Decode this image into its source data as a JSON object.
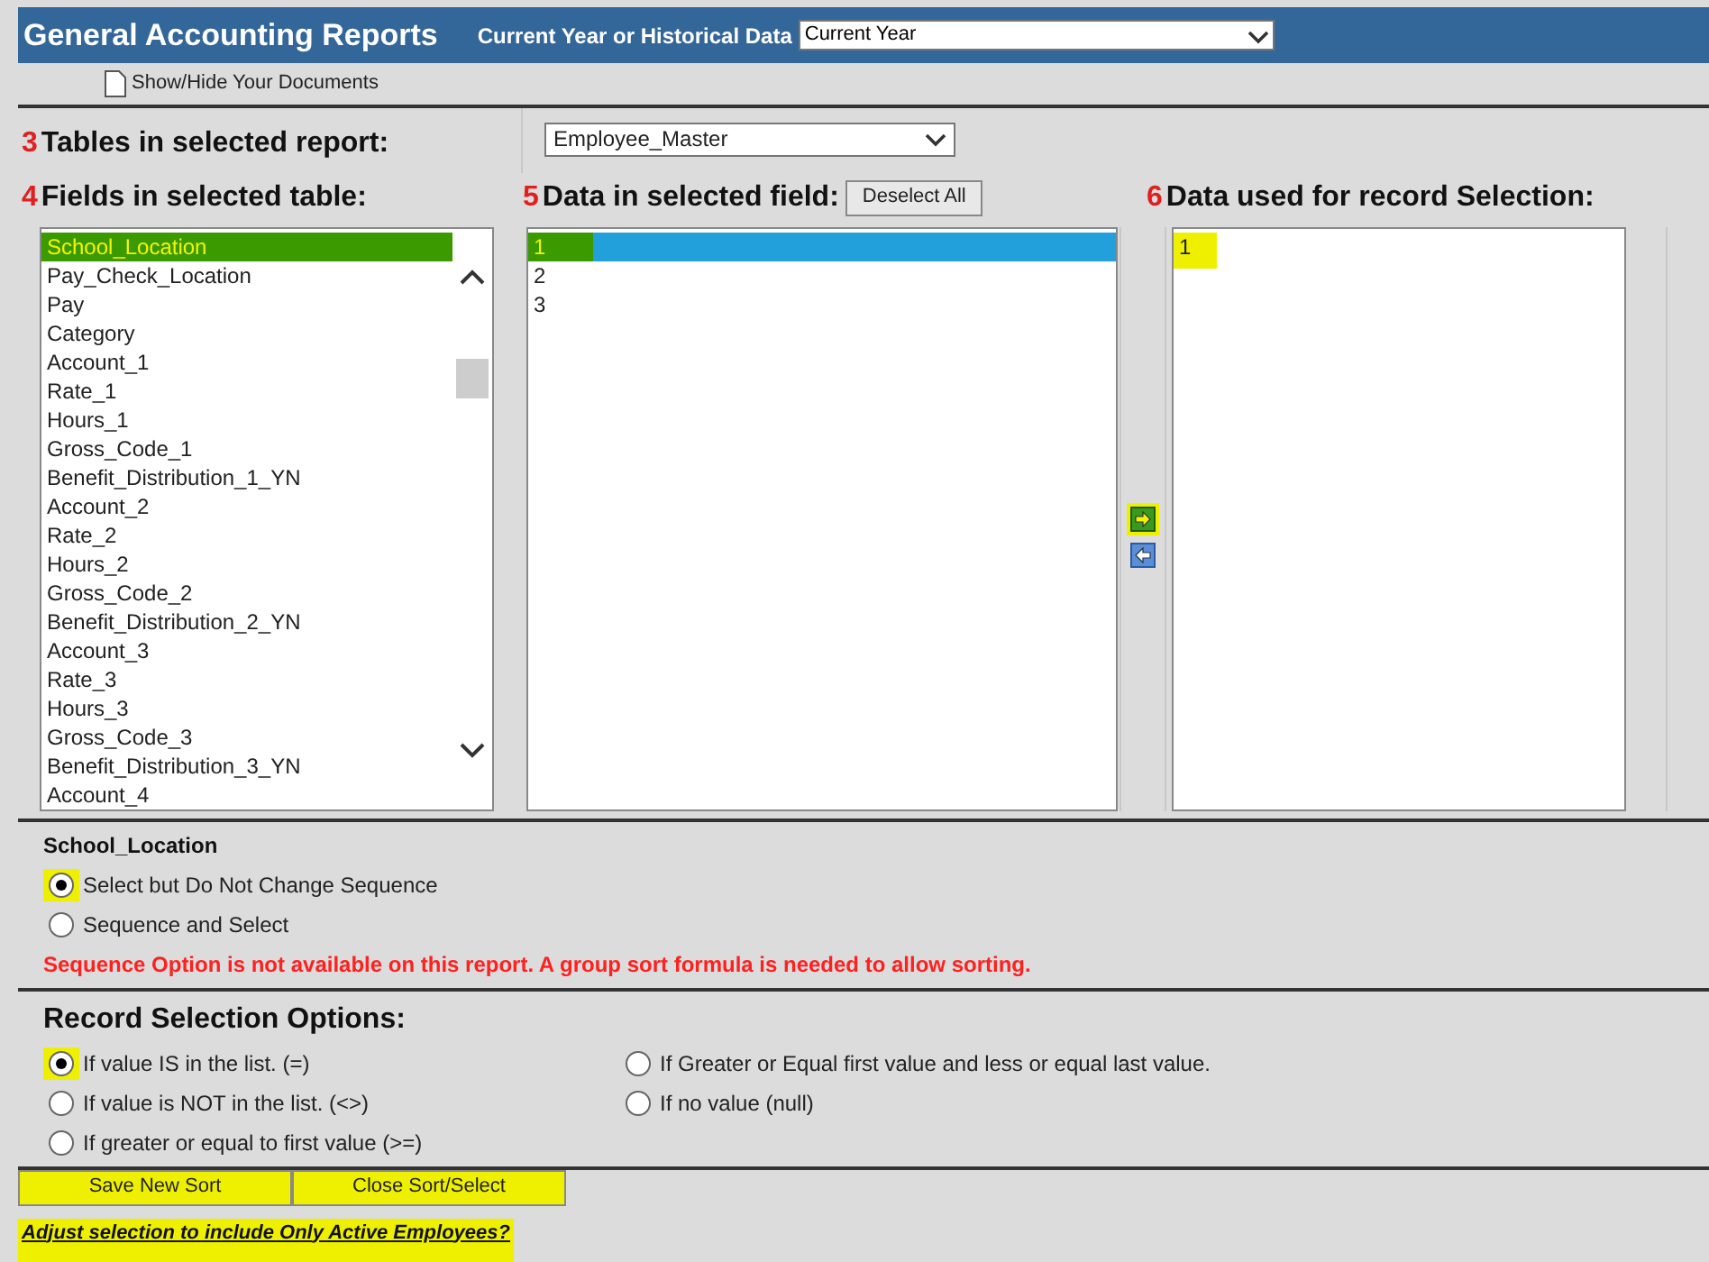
{
  "header": {
    "title": "General Accounting Reports",
    "year_label": "Current Year or Historical Data",
    "year_value": "Current Year"
  },
  "toolbar": {
    "documents_button": "Show/Hide Your Documents"
  },
  "tables": {
    "step": "3",
    "label": "Tables in selected report:",
    "value": "Employee_Master"
  },
  "fields": {
    "step": "4",
    "label": "Fields in selected table:",
    "items": [
      {
        "label": "School_Location",
        "selected": true,
        "highlighted": true
      },
      {
        "label": "Pay_Check_Location",
        "selected": false,
        "highlighted": false
      },
      {
        "label": "Pay",
        "selected": false,
        "highlighted": false
      },
      {
        "label": "Category",
        "selected": false,
        "highlighted": false
      },
      {
        "label": "Account_1",
        "selected": false,
        "highlighted": false
      },
      {
        "label": "Rate_1",
        "selected": false,
        "highlighted": false
      },
      {
        "label": "Hours_1",
        "selected": false,
        "highlighted": false
      },
      {
        "label": "Gross_Code_1",
        "selected": false,
        "highlighted": false
      },
      {
        "label": "Benefit_Distribution_1_YN",
        "selected": false,
        "highlighted": false
      },
      {
        "label": "Account_2",
        "selected": false,
        "highlighted": false
      },
      {
        "label": "Rate_2",
        "selected": false,
        "highlighted": false
      },
      {
        "label": "Hours_2",
        "selected": false,
        "highlighted": false
      },
      {
        "label": "Gross_Code_2",
        "selected": false,
        "highlighted": false
      },
      {
        "label": "Benefit_Distribution_2_YN",
        "selected": false,
        "highlighted": false
      },
      {
        "label": "Account_3",
        "selected": false,
        "highlighted": false
      },
      {
        "label": "Rate_3",
        "selected": false,
        "highlighted": false
      },
      {
        "label": "Hours_3",
        "selected": false,
        "highlighted": false
      },
      {
        "label": "Gross_Code_3",
        "selected": false,
        "highlighted": false
      },
      {
        "label": "Benefit_Distribution_3_YN",
        "selected": false,
        "highlighted": false
      },
      {
        "label": "Account_4",
        "selected": false,
        "highlighted": false
      }
    ]
  },
  "data": {
    "step": "5",
    "label": "Data in selected field:",
    "deselect_button": "Deselect All",
    "items": [
      {
        "label": "1",
        "selected": true,
        "highlighted": true
      },
      {
        "label": "2",
        "selected": false,
        "highlighted": false
      },
      {
        "label": "3",
        "selected": false,
        "highlighted": false
      }
    ]
  },
  "transfer_buttons": [
    {
      "kind": "add",
      "highlighted": true
    },
    {
      "kind": "remove",
      "highlighted": false
    }
  ],
  "selection": {
    "step": "6",
    "label": "Data used for record Selection:",
    "items": [
      {
        "label": "1",
        "highlighted": true
      }
    ]
  },
  "sequence": {
    "field": "School_Location",
    "options": [
      {
        "label": "Select but Do Not Change Sequence",
        "selected": true,
        "highlighted": true
      },
      {
        "label": "Sequence and Select",
        "selected": false,
        "highlighted": false
      }
    ],
    "warning": "Sequence Option is not available on this report. A group sort formula is needed to allow sorting."
  },
  "record_selection": {
    "title": "Record Selection Options:",
    "options": [
      {
        "label": "If value IS  in the list. (=)",
        "selected": true,
        "highlighted": true
      },
      {
        "label": "If value is NOT in the list. (<>)",
        "selected": false,
        "highlighted": false
      },
      {
        "label": "If greater or equal to first value (>=)",
        "selected": false,
        "highlighted": false
      },
      {
        "label": "If Greater or Equal first value and less or equal last value.",
        "selected": false,
        "highlighted": false
      },
      {
        "label": "If no value (null)",
        "selected": false,
        "highlighted": false
      }
    ]
  },
  "buttons": [
    {
      "label": "Save New Sort",
      "highlighted": true
    },
    {
      "label": "Close Sort/Select",
      "highlighted": true
    }
  ],
  "link": {
    "label": "Adjust selection to include Only Active Employees?",
    "highlighted": true
  }
}
